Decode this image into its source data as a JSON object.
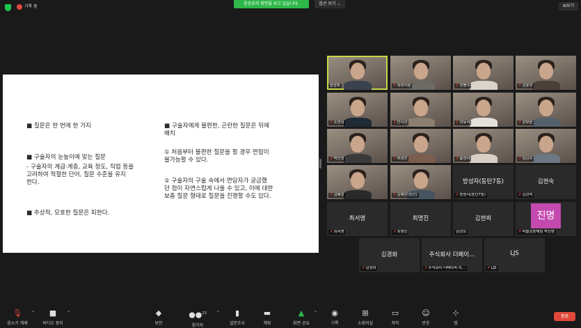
{
  "topbar": {
    "recording_label": "기록 중",
    "share_banner": "윤승호의 화면을 보고 있습니다.",
    "view_options": "옵션 보기",
    "view_button": "보기"
  },
  "slide": {
    "left_col": [
      "■ 질문은 한 번에 한 가지",
      "■ 구술자의 눈높이에 맞는 질문",
      "- 구술자의 계급·계층, 교육 정도, 직업 등을\n  고려하여 적절한 단어, 질문 수준을 유지\n  한다.",
      "■ 추상적, 모호한 질문은 피한다."
    ],
    "right_col": [
      "■ 구술자에게 불편한, 곤란한 질문은 뒤에\n  배치",
      "① 처음부터 불편한 질문을 할 경우 면접이\n  불가능할 수 있다.",
      "② 구술자의 구술 속에서 면담자가 궁금했\n  던 점이 자연스럽게 나올 수 있고, 이에 대한\n  보충 질문 형태로 질문을 진행할 수도 있다."
    ]
  },
  "participants": [
    {
      "label": "윤승호",
      "muted": false,
      "video": true,
      "active": true
    },
    {
      "label": "최성아음",
      "muted": true,
      "video": true
    },
    {
      "label": "정봉주",
      "muted": true,
      "video": true
    },
    {
      "label": "김윤정",
      "muted": true,
      "video": true
    },
    {
      "label": "소연희",
      "muted": true,
      "video": true
    },
    {
      "label": "안지현",
      "muted": true,
      "video": true
    },
    {
      "label": "이유리",
      "muted": true,
      "video": true
    },
    {
      "label": "장보윤",
      "muted": true,
      "video": true
    },
    {
      "label": "박민정",
      "muted": true,
      "video": true
    },
    {
      "label": "하경선",
      "muted": true,
      "video": true
    },
    {
      "label": "황정아",
      "muted": true,
      "video": true
    },
    {
      "label": "임감수",
      "muted": true,
      "video": true
    },
    {
      "label": "김혜정",
      "muted": true,
      "video": true
    },
    {
      "label": "김혜란(동탄)",
      "muted": true,
      "video": true
    },
    {
      "big": "방성자(동탄7동)",
      "label": "방성자(동탄7동)",
      "muted": true
    },
    {
      "big": "김현숙",
      "label": "김현숙",
      "muted": true
    },
    {
      "big": "최서영",
      "label": "최서영",
      "muted": true
    },
    {
      "big": "최명진",
      "label": "최명진",
      "muted": true
    },
    {
      "big": "김현희",
      "label": "김현희",
      "muted": false
    },
    {
      "avatar": "진명",
      "label": "마을공동체팀 박진명",
      "muted": true
    },
    {
      "big": "김경화",
      "label": "김경화",
      "muted": true
    },
    {
      "big": "주식회사 더페이...",
      "label": "주식회사 더페이퍼 이...",
      "muted": true
    },
    {
      "big": "LJS",
      "label": "LJS",
      "muted": true
    }
  ],
  "toolbar": {
    "unmute": "음소거 해제",
    "start_video": "비디오 중지",
    "security": "보안",
    "participants": "참가자",
    "participant_count": "23",
    "polls": "설문조사",
    "chat": "채팅",
    "share_screen": "화면 공유",
    "record": "기록",
    "breakout": "소회의실",
    "captions": "자막",
    "reactions": "반응",
    "apps": "앱",
    "end": "종료"
  },
  "colors": {
    "accent_green": "#2fb84a",
    "end_red": "#e0483c",
    "active_speaker": "#c7d84a",
    "avatar_purple": "#c44ab0"
  }
}
